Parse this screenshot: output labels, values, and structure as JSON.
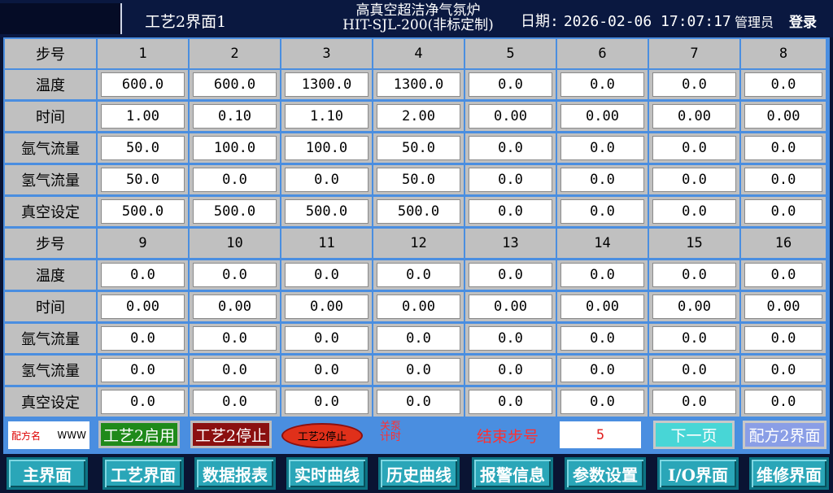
{
  "header": {
    "page_title": "工艺2界面1",
    "machine_name": "高真空超洁净气氛炉",
    "machine_model": "HIT-SJL-200(非标定制)",
    "date_label": "日期:",
    "datetime": "2026-02-06 17:07:17",
    "user": "管理员",
    "login": "登录"
  },
  "table": {
    "row_labels": [
      "步号",
      "温度",
      "时间",
      "氩气流量",
      "氢气流量",
      "真空设定"
    ],
    "block1": {
      "steps": [
        "1",
        "2",
        "3",
        "4",
        "5",
        "6",
        "7",
        "8"
      ],
      "temperature": [
        "600.0",
        "600.0",
        "1300.0",
        "1300.0",
        "0.0",
        "0.0",
        "0.0",
        "0.0"
      ],
      "time": [
        "1.00",
        "0.10",
        "1.10",
        "2.00",
        "0.00",
        "0.00",
        "0.00",
        "0.00"
      ],
      "argon": [
        "50.0",
        "100.0",
        "100.0",
        "50.0",
        "0.0",
        "0.0",
        "0.0",
        "0.0"
      ],
      "hydrogen": [
        "50.0",
        "0.0",
        "0.0",
        "50.0",
        "0.0",
        "0.0",
        "0.0",
        "0.0"
      ],
      "vacuum": [
        "500.0",
        "500.0",
        "500.0",
        "500.0",
        "0.0",
        "0.0",
        "0.0",
        "0.0"
      ]
    },
    "block2": {
      "steps": [
        "9",
        "10",
        "11",
        "12",
        "13",
        "14",
        "15",
        "16"
      ],
      "temperature": [
        "0.0",
        "0.0",
        "0.0",
        "0.0",
        "0.0",
        "0.0",
        "0.0",
        "0.0"
      ],
      "time": [
        "0.00",
        "0.00",
        "0.00",
        "0.00",
        "0.00",
        "0.00",
        "0.00",
        "0.00"
      ],
      "argon": [
        "0.0",
        "0.0",
        "0.0",
        "0.0",
        "0.0",
        "0.0",
        "0.0",
        "0.0"
      ],
      "hydrogen": [
        "0.0",
        "0.0",
        "0.0",
        "0.0",
        "0.0",
        "0.0",
        "0.0",
        "0.0"
      ],
      "vacuum": [
        "0.0",
        "0.0",
        "0.0",
        "0.0",
        "0.0",
        "0.0",
        "0.0",
        "0.0"
      ]
    }
  },
  "controls": {
    "recipe_label": "配方名",
    "recipe_value": "WWW",
    "start_button": "工艺2启用",
    "stop_button": "工艺2停止",
    "status_indicator": "工艺2停止",
    "pump_timer_line1": "关泵",
    "pump_timer_line2": "计时",
    "end_step_label": "结束步号",
    "end_step_value": "5",
    "next_page": "下一页",
    "recipe2_page": "配方2界面"
  },
  "nav": [
    "主界面",
    "工艺界面",
    "数据报表",
    "实时曲线",
    "历史曲线",
    "报警信息",
    "参数设置",
    "I/O界面",
    "维修界面"
  ],
  "colors": {
    "grid_blue": "#4a8ee0",
    "label_gray": "#c0c0c0",
    "start_green": "#1f8a1a",
    "stop_red": "#8b1010",
    "indicator_red": "#e0301a",
    "nav_teal": "#2aa6b8",
    "next_cyan": "#48d6d6",
    "recipe_button": "#8a9ee6"
  }
}
